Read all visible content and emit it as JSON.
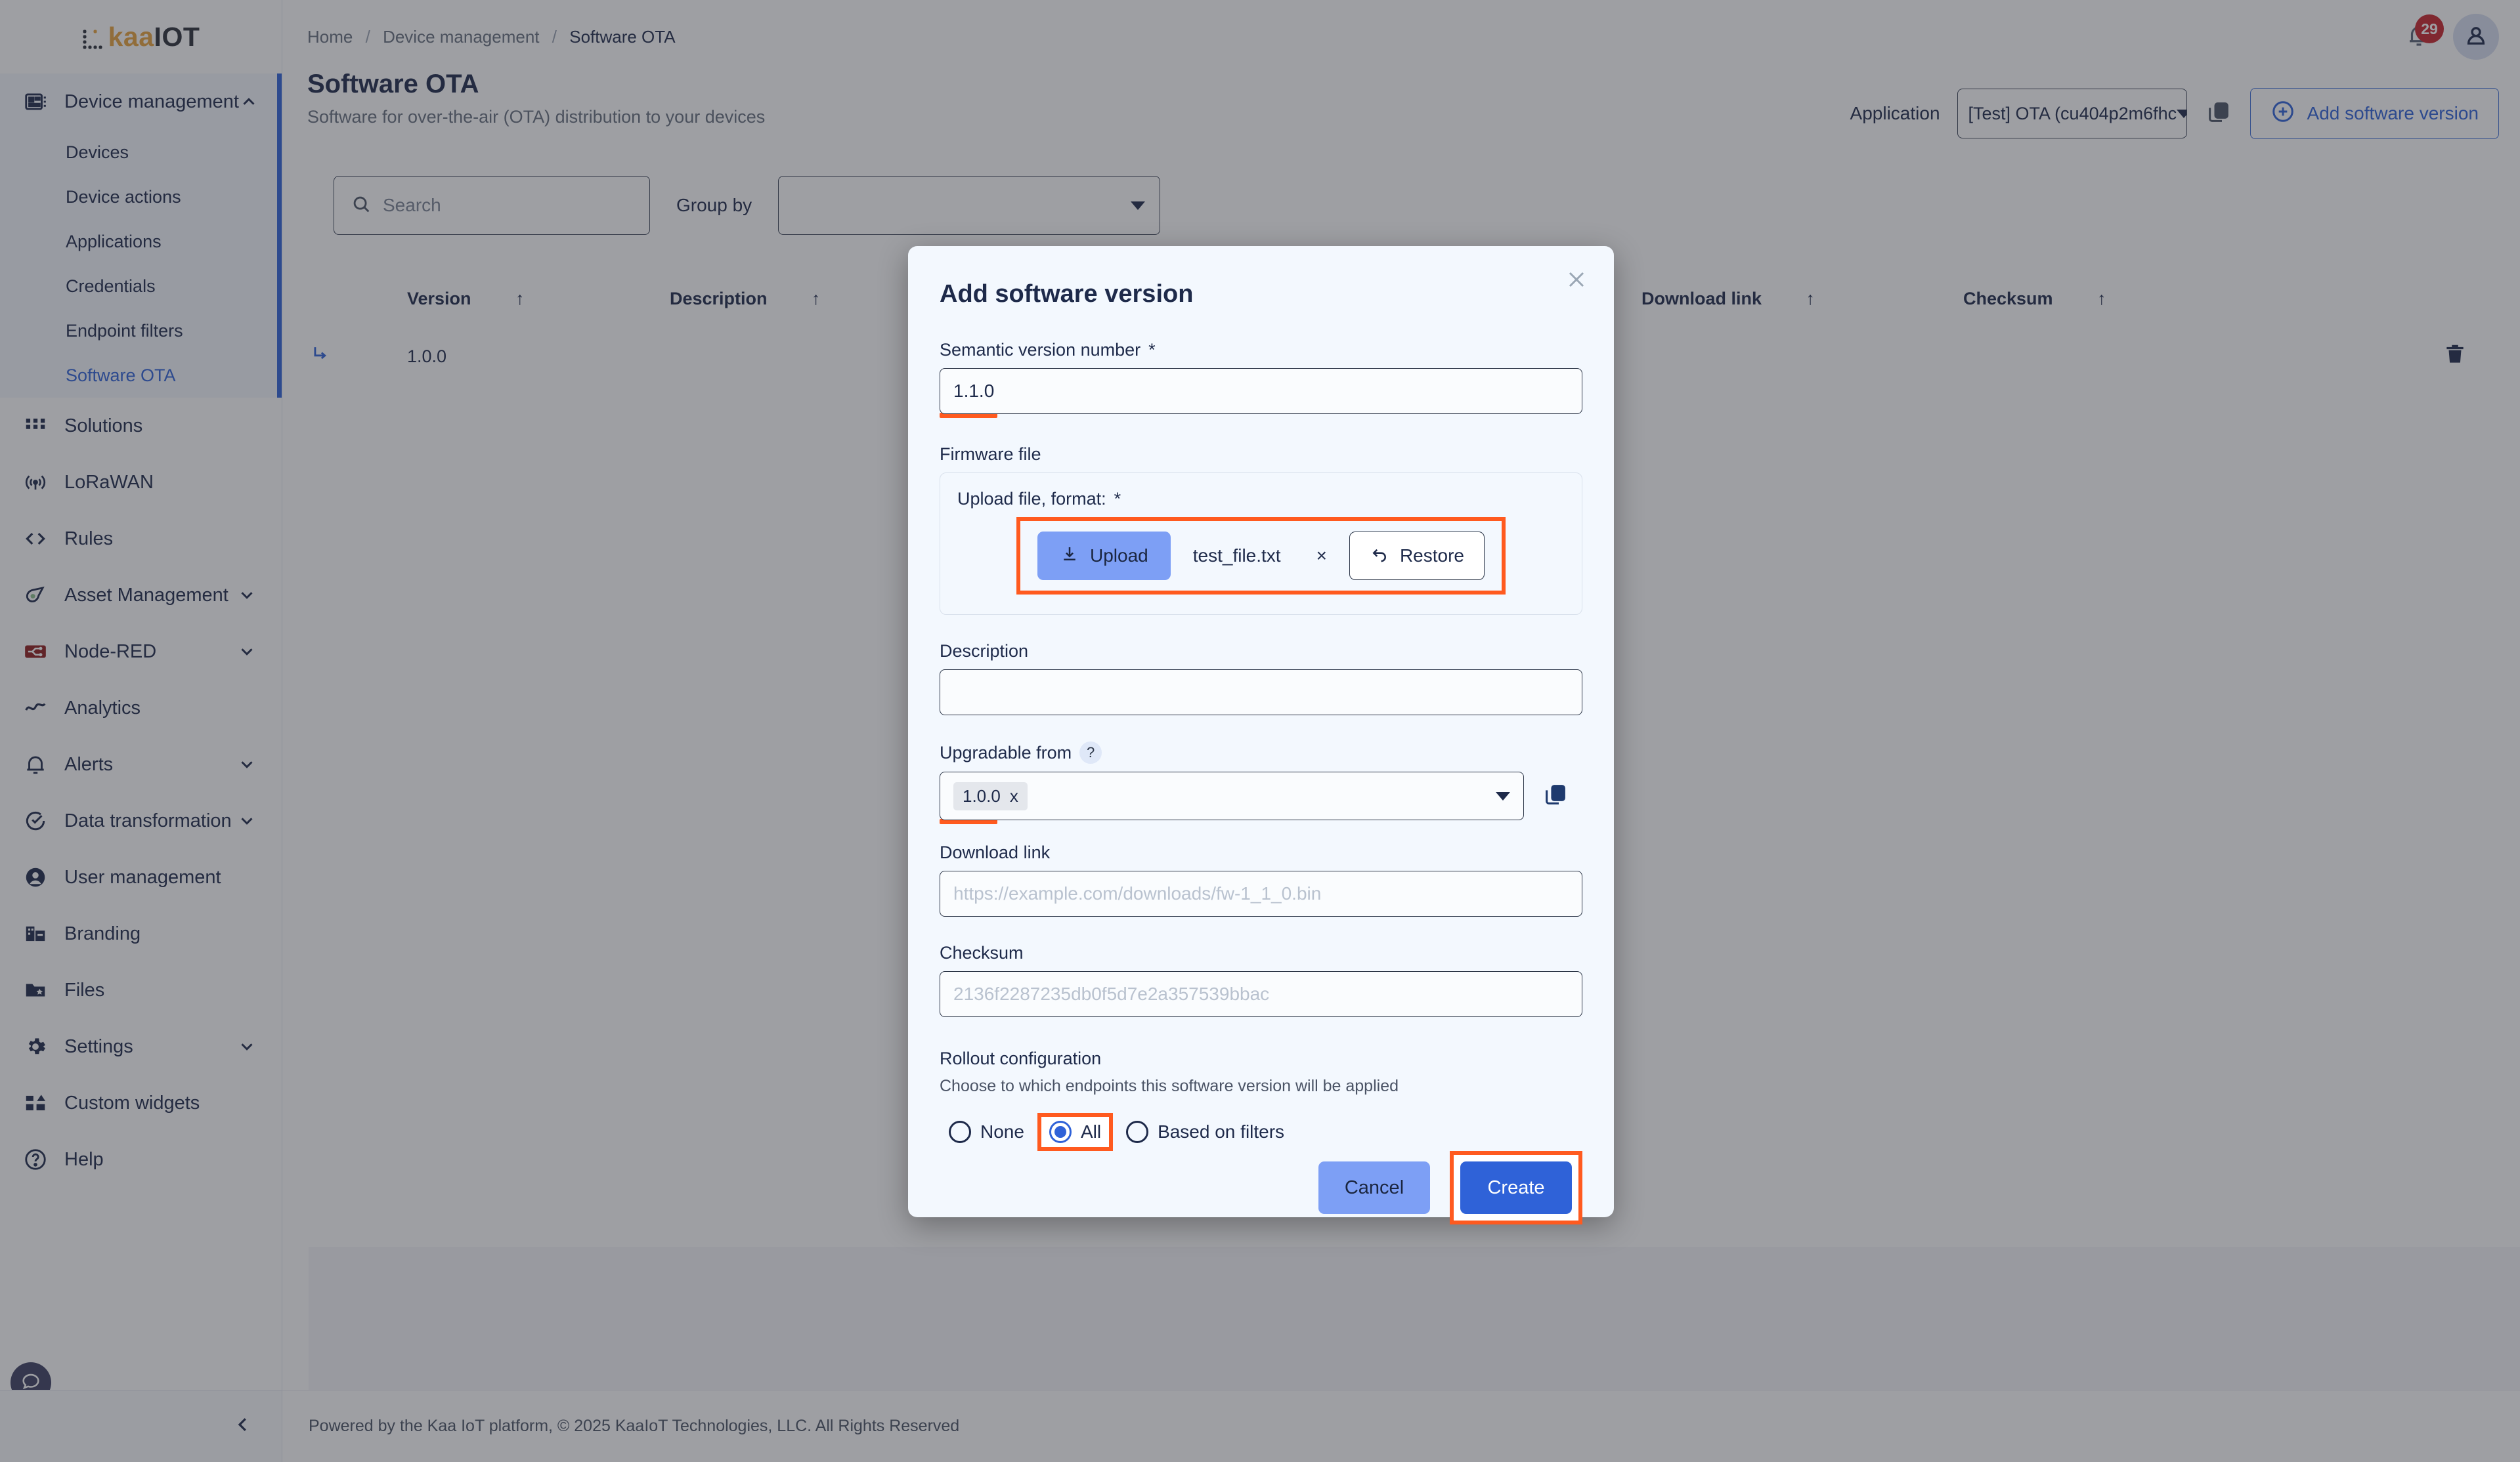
{
  "brand": {
    "mark": "kaa-logo-mark",
    "name_accent": "kaa",
    "name_rest": "IOT"
  },
  "sidebar": {
    "group": {
      "label": "Device management",
      "icon": "device-chip-icon",
      "chevron": "chevron-up-icon",
      "children": [
        {
          "label": "Devices",
          "active": false
        },
        {
          "label": "Device actions",
          "active": false
        },
        {
          "label": "Applications",
          "active": false
        },
        {
          "label": "Credentials",
          "active": false
        },
        {
          "label": "Endpoint filters",
          "active": false
        },
        {
          "label": "Software OTA",
          "active": true
        }
      ]
    },
    "items": [
      {
        "label": "Solutions",
        "icon": "grid-icon",
        "chevron": false
      },
      {
        "label": "LoRaWAN",
        "icon": "antenna-icon",
        "chevron": false
      },
      {
        "label": "Rules",
        "icon": "code-brackets-icon",
        "chevron": false
      },
      {
        "label": "Asset Management",
        "icon": "tag-icon",
        "chevron": true
      },
      {
        "label": "Node-RED",
        "icon": "node-red-icon",
        "chevron": true
      },
      {
        "label": "Analytics",
        "icon": "analytics-icon",
        "chevron": false
      },
      {
        "label": "Alerts",
        "icon": "bell-icon",
        "chevron": true
      },
      {
        "label": "Data transformation",
        "icon": "transform-icon",
        "chevron": true
      },
      {
        "label": "User management",
        "icon": "user-circle-icon",
        "chevron": false
      },
      {
        "label": "Branding",
        "icon": "building-icon",
        "chevron": false
      },
      {
        "label": "Files",
        "icon": "folder-star-icon",
        "chevron": false
      },
      {
        "label": "Settings",
        "icon": "gear-icon",
        "chevron": true
      },
      {
        "label": "Custom widgets",
        "icon": "widgets-icon",
        "chevron": false
      },
      {
        "label": "Help",
        "icon": "question-circle-icon",
        "chevron": false
      }
    ],
    "feedback_icon": "chat-bubble-icon",
    "collapse_icon": "chevron-left-icon"
  },
  "topbar": {
    "breadcrumb": {
      "home": "Home",
      "section": "Device management",
      "current": "Software OTA",
      "separator": "/"
    },
    "bell_icon": "bell-icon",
    "notification_count": "29",
    "avatar_icon": "user-icon"
  },
  "pagehead": {
    "title": "Software OTA",
    "subtitle": "Software for over-the-air (OTA) distribution to your devices",
    "application_label": "Application",
    "application_value": "[Test] OTA (cu404p2m6fhc",
    "copy_icon": "copy-icon",
    "add_button": "Add software version",
    "add_icon": "plus-circle-icon"
  },
  "toolbar": {
    "search_placeholder": "Search",
    "search_value": "",
    "search_icon": "search-icon",
    "groupby_label": "Group by",
    "groupby_value": ""
  },
  "table": {
    "columns": [
      "Version",
      "Description",
      "Download link",
      "Checksum"
    ],
    "sort_arrow": "↑",
    "rows": [
      {
        "expand_icon": "sub-arrow-icon",
        "version": "1.0.0",
        "description": "",
        "download_link": "",
        "checksum": "",
        "delete_icon": "trash-icon"
      }
    ]
  },
  "footer": {
    "text": "Powered by the Kaa IoT platform, © 2025 KaaIoT Technologies, LLC. All Rights Reserved"
  },
  "modal": {
    "title": "Add software version",
    "close_icon": "close-icon",
    "semantic_version": {
      "label": "Semantic version number",
      "required_mark": "*",
      "value": "1.1.0"
    },
    "firmware": {
      "section_label": "Firmware file",
      "upload_label": "Upload file, format:",
      "required_mark": "*",
      "upload_button": "Upload",
      "upload_icon": "download-arrow-icon",
      "file_name": "test_file.txt",
      "file_remove": "×",
      "restore_button": "Restore",
      "restore_icon": "undo-icon"
    },
    "description": {
      "label": "Description",
      "value": "",
      "placeholder": ""
    },
    "upgradable_from": {
      "label": "Upgradable from",
      "help_icon": "question-mark-icon",
      "chips": [
        "1.0.0"
      ],
      "chip_remove": "x",
      "copy_icon": "copy-icon"
    },
    "download_link": {
      "label": "Download link",
      "value": "",
      "placeholder": "https://example.com/downloads/fw-1_1_0.bin"
    },
    "checksum": {
      "label": "Checksum",
      "value": "",
      "placeholder": "2136f2287235db0f5d7e2a357539bbac"
    },
    "rollout": {
      "label": "Rollout configuration",
      "hint": "Choose to which endpoints this software version will be applied",
      "options": [
        {
          "label": "None",
          "selected": false,
          "highlighted": false
        },
        {
          "label": "All",
          "selected": true,
          "highlighted": true
        },
        {
          "label": "Based on filters",
          "selected": false,
          "highlighted": false
        }
      ]
    },
    "cancel_button": "Cancel",
    "create_button": "Create"
  },
  "colors": {
    "accent_blue": "#2f62d8",
    "highlight_orange": "#ff5a1f",
    "brand_amber": "#e8a33d",
    "badge_red": "#c8242c",
    "modal_bg": "#f3f8fe"
  }
}
